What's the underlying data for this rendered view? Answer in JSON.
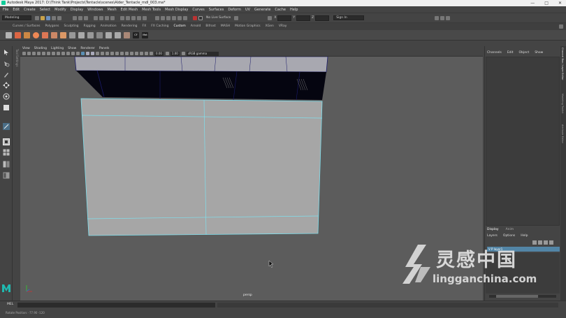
{
  "window": {
    "title": "Autodesk Maya 2017: D:\\Think Tank\\Projects\\Tentacle\\scenes\\Alder_Tentacle_mdl_003.ma*"
  },
  "menubar": {
    "items": [
      "File",
      "Edit",
      "Create",
      "Select",
      "Modify",
      "Display",
      "Windows",
      "Mesh",
      "Edit Mesh",
      "Mesh Tools",
      "Mesh Display",
      "Curves",
      "Surfaces",
      "Deform",
      "UV",
      "Generate",
      "Cache",
      "Help"
    ],
    "workspace_label": "Workspace :",
    "workspace_value": "Maya Classic*"
  },
  "statusline": {
    "mode": "Modeling",
    "live_surface": "No Live Surface",
    "x_label": "X",
    "y_label": "Y",
    "z_label": "Z",
    "sign_in": "Sign In"
  },
  "shelf": {
    "tabs": [
      "Curves / Surfaces",
      "Polygons",
      "Sculpting",
      "Rigging",
      "Animation",
      "Rendering",
      "FX",
      "FX Caching",
      "Custom",
      "Arnold",
      "Bifrost",
      "MASH",
      "Motion Graphics",
      "XGen",
      "VRay"
    ],
    "active_tab": "Custom",
    "icon_labels": [
      "CF",
      "Mat"
    ]
  },
  "toolbox": {
    "side_text": "Tool Settings"
  },
  "panel": {
    "menu": [
      "View",
      "Shading",
      "Lighting",
      "Show",
      "Renderer",
      "Panels"
    ],
    "field_a": "0.00",
    "field_b": "1.00",
    "color_space": "sRGB gamma",
    "camera_label": "persp"
  },
  "channel_box": {
    "menu": [
      "Channels",
      "Edit",
      "Object",
      "Show"
    ]
  },
  "layer_editor": {
    "tabs": [
      "Display",
      "Anim"
    ],
    "menu": [
      "Layers",
      "Options",
      "Help"
    ],
    "layer_row": "V P    layer1"
  },
  "side_tabs": [
    "Channel Box / Layer Editor",
    "Modeling Toolkit",
    "Attribute Editor"
  ],
  "cmdline": {
    "label": "MEL"
  },
  "helpline": {
    "text": "Rotate Position: -77.90   -120"
  },
  "watermark": {
    "cn": "灵感中国",
    "en": "lingganchina.com"
  },
  "colors": {
    "accent": "#5285a6",
    "viewport_bg": "#5c5c5c",
    "plane_fill": "#a6a6a6",
    "edge_highlight": "#7fe0ee"
  }
}
